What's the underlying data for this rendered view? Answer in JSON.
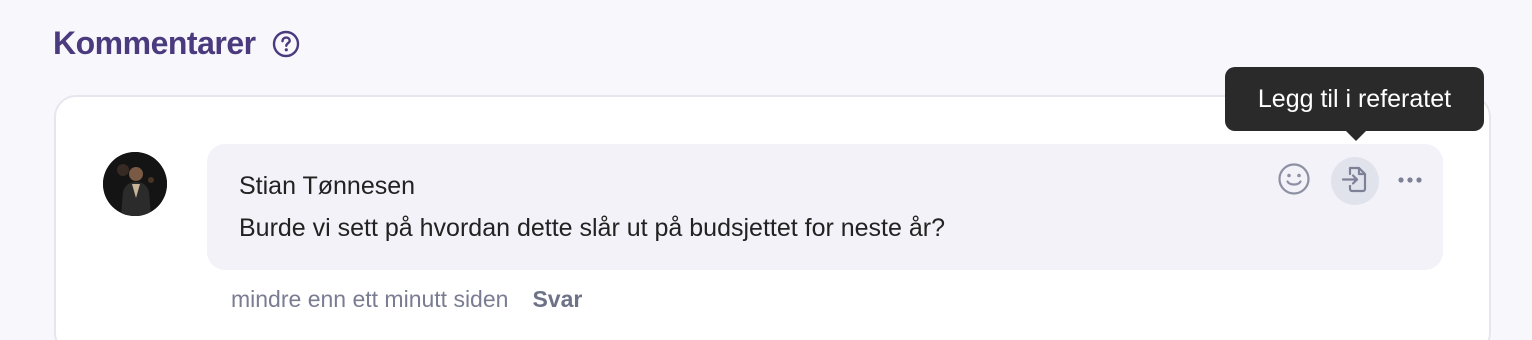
{
  "section": {
    "title": "Kommentarer",
    "help_icon": "question-circle-icon"
  },
  "comment": {
    "author": "Stian Tønnesen",
    "text": "Burde vi sett på hvordan dette slår ut på budsjettet for neste år?",
    "time": "mindre enn ett minutt siden",
    "reply_label": "Svar",
    "actions": {
      "emoji_icon": "smiley-icon",
      "add_icon": "add-to-minutes-icon",
      "more_icon": "more-horizontal-icon"
    }
  },
  "tooltip": {
    "text": "Legg til i referatet"
  },
  "colors": {
    "title": "#4b3a7e",
    "tooltip_bg": "#2a2a2a",
    "bubble_bg": "#f2f2f8"
  }
}
